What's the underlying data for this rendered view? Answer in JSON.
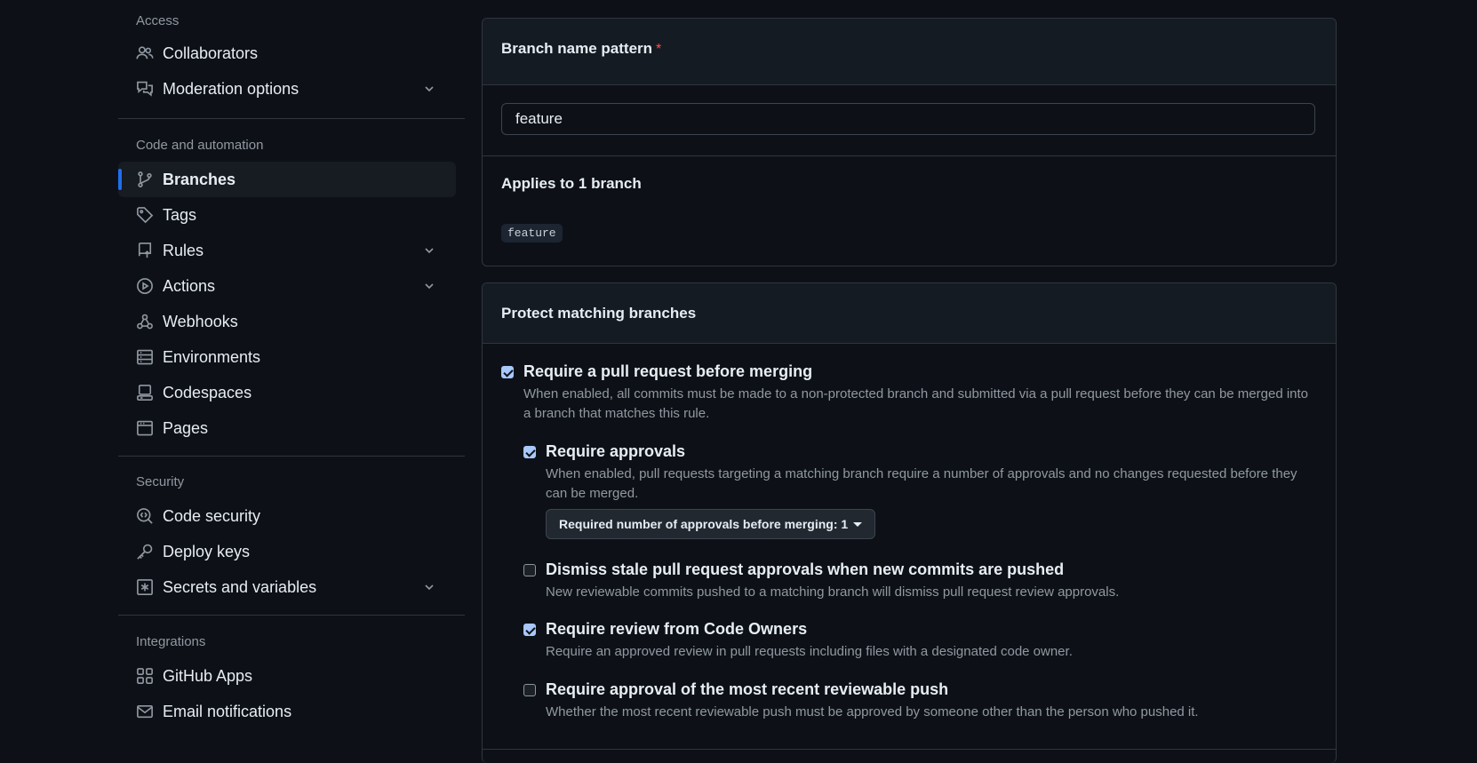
{
  "sidebar": {
    "access_title": "Access",
    "access_items": [
      {
        "label": "Collaborators",
        "icon": "people-icon"
      },
      {
        "label": "Moderation options",
        "icon": "comment-discussion-icon",
        "expandable": true
      }
    ],
    "code_title": "Code and automation",
    "code_items": [
      {
        "label": "Branches",
        "icon": "git-branch-icon",
        "active": true
      },
      {
        "label": "Tags",
        "icon": "tag-icon"
      },
      {
        "label": "Rules",
        "icon": "repo-push-icon",
        "expandable": true
      },
      {
        "label": "Actions",
        "icon": "play-icon",
        "expandable": true
      },
      {
        "label": "Webhooks",
        "icon": "webhook-icon"
      },
      {
        "label": "Environments",
        "icon": "server-icon"
      },
      {
        "label": "Codespaces",
        "icon": "codespaces-icon"
      },
      {
        "label": "Pages",
        "icon": "browser-icon"
      }
    ],
    "security_title": "Security",
    "security_items": [
      {
        "label": "Code security",
        "icon": "codescan-icon"
      },
      {
        "label": "Deploy keys",
        "icon": "key-icon"
      },
      {
        "label": "Secrets and variables",
        "icon": "key-asterisk-icon",
        "expandable": true
      }
    ],
    "integrations_title": "Integrations",
    "integrations_items": [
      {
        "label": "GitHub Apps",
        "icon": "apps-icon"
      },
      {
        "label": "Email notifications",
        "icon": "mail-icon"
      }
    ]
  },
  "branch_pattern": {
    "title": "Branch name pattern",
    "required_mark": "*",
    "value": "feature",
    "applies_text": "Applies to 1 branch",
    "matching_branch": "feature"
  },
  "protect": {
    "title": "Protect matching branches",
    "options": [
      {
        "label": "Require a pull request before merging",
        "checked": true,
        "desc": "When enabled, all commits must be made to a non-protected branch and submitted via a pull request before they can be merged into a branch that matches this rule."
      },
      {
        "label": "Require approvals",
        "checked": true,
        "desc": "When enabled, pull requests targeting a matching branch require a number of approvals and no changes requested before they can be merged."
      },
      {
        "label": "Dismiss stale pull request approvals when new commits are pushed",
        "checked": false,
        "desc": "New reviewable commits pushed to a matching branch will dismiss pull request review approvals."
      },
      {
        "label": "Require review from Code Owners",
        "checked": true,
        "desc": "Require an approved review in pull requests including files with a designated code owner."
      },
      {
        "label": "Require approval of the most recent reviewable push",
        "checked": false,
        "desc": "Whether the most recent reviewable push must be approved by someone other than the person who pushed it."
      }
    ],
    "approvals_select": "Required number of approvals before merging: 1"
  },
  "colors": {
    "accent": "#1f6feb",
    "checkbox": "#a8c7fa",
    "required": "#f85149"
  }
}
